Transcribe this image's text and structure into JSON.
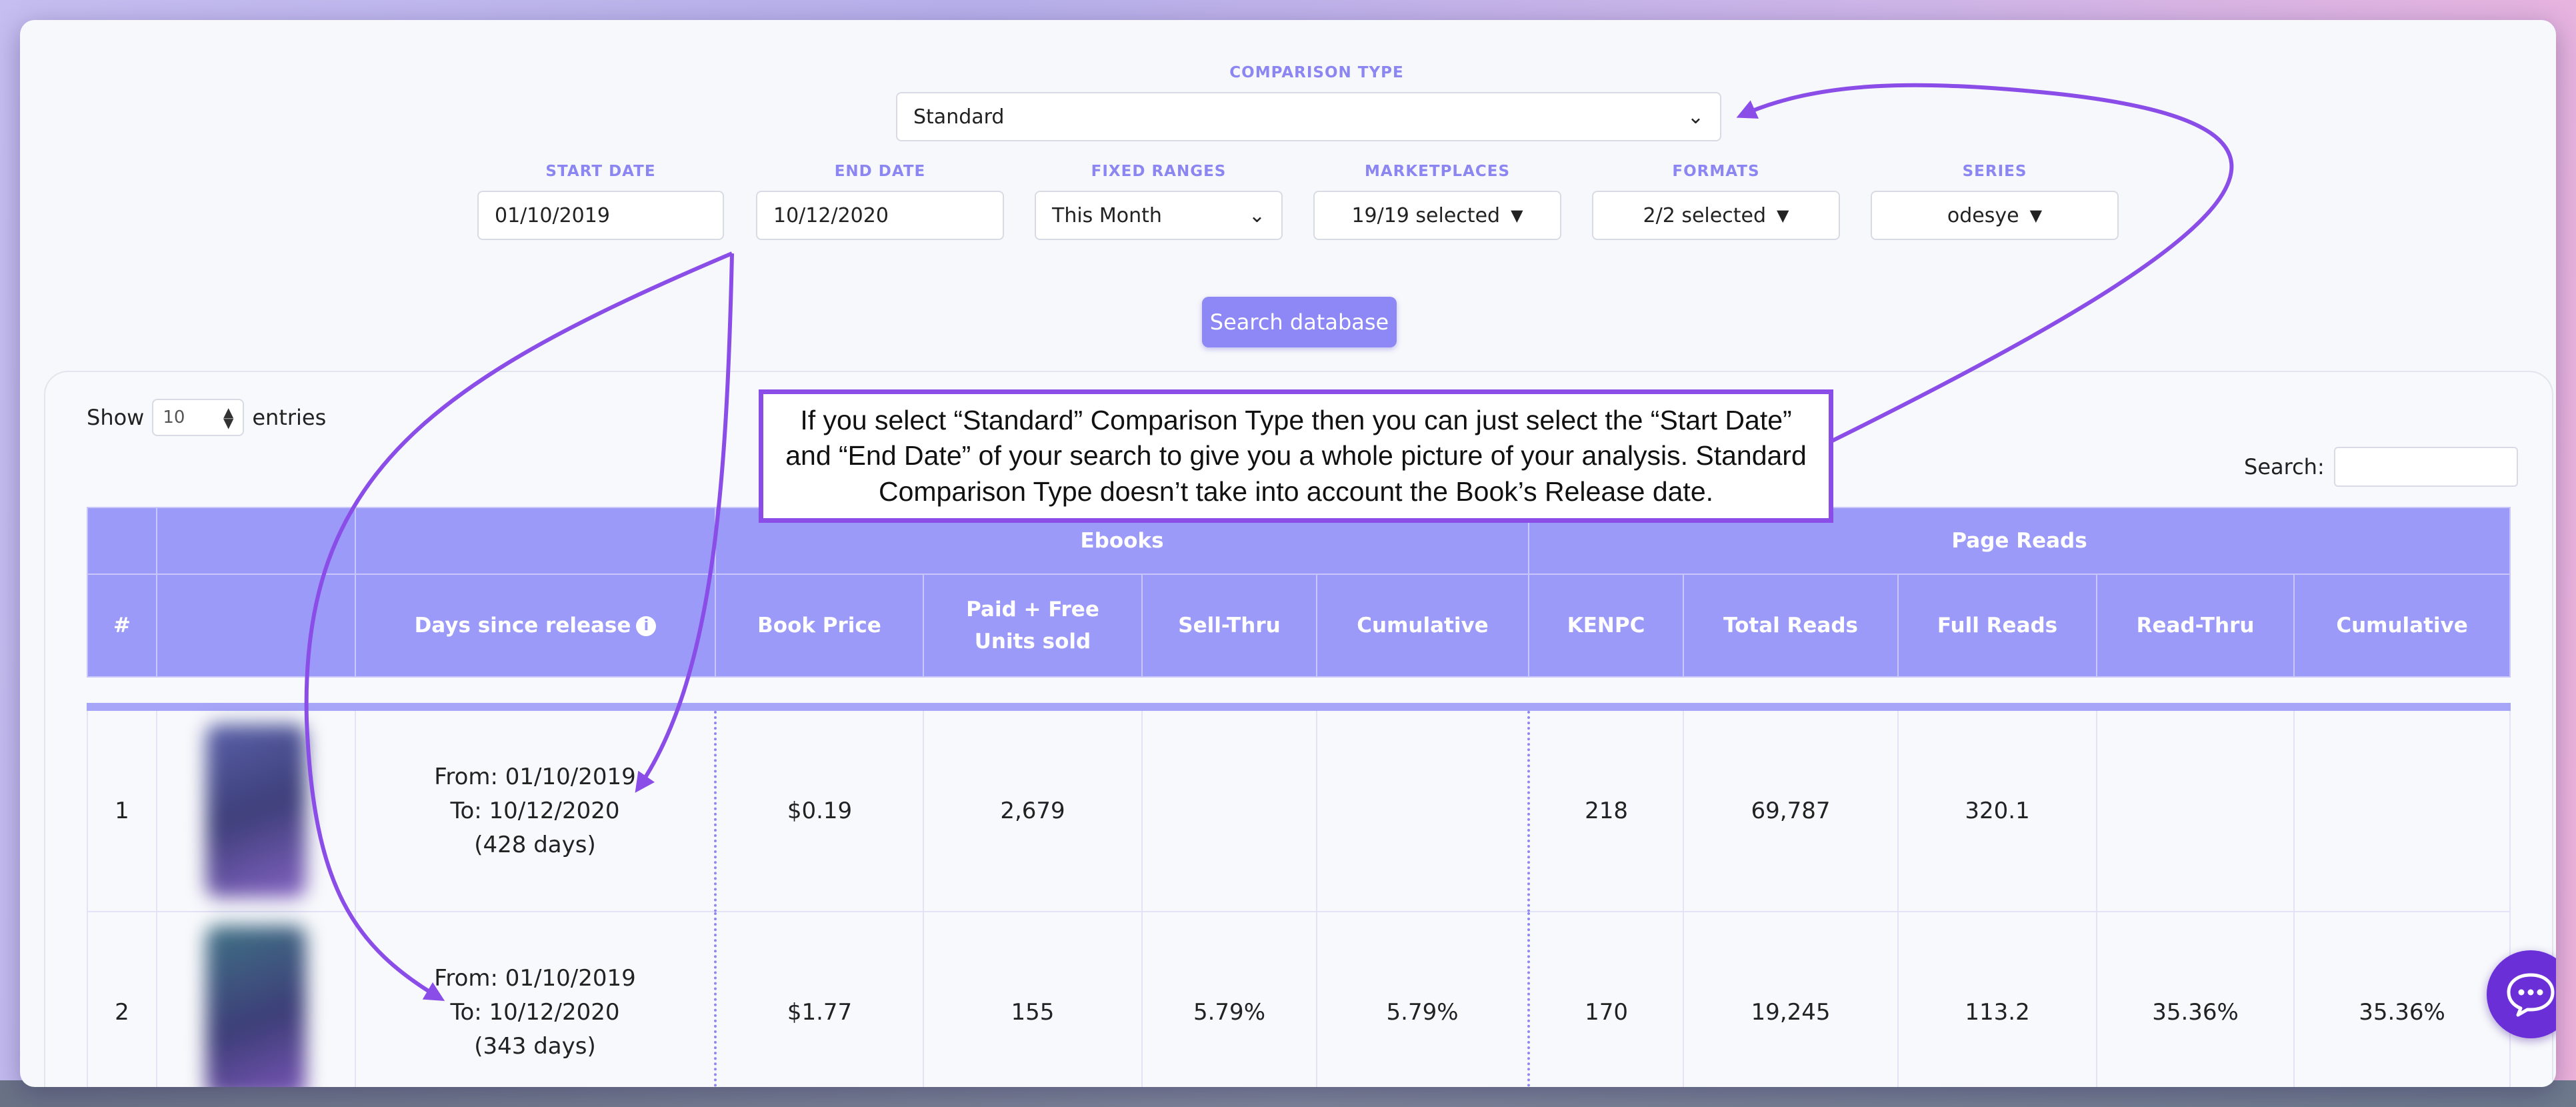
{
  "filters": {
    "comparison_type": {
      "label": "COMPARISON TYPE",
      "value": "Standard"
    },
    "start_date": {
      "label": "START DATE",
      "value": "01/10/2019"
    },
    "end_date": {
      "label": "END DATE",
      "value": "10/12/2020"
    },
    "fixed_ranges": {
      "label": "FIXED RANGES",
      "value": "This Month"
    },
    "marketplaces": {
      "label": "MARKETPLACES",
      "value": "19/19 selected"
    },
    "formats": {
      "label": "FORMATS",
      "value": "2/2 selected"
    },
    "series": {
      "label": "SERIES",
      "value": "odesye"
    },
    "search_button": "Search database"
  },
  "table_controls": {
    "show_label": "Show",
    "entries_value": "10",
    "entries_label": "entries",
    "search_label": "Search:"
  },
  "callout": {
    "text": "If you select “Standard” Comparison Type then you can just select the “Start Date” and “End Date” of your search to give you a whole picture of your analysis. Standard Comparison Type doesn’t take into account the Book’s Release date."
  },
  "table": {
    "groups": {
      "ebooks": "Ebooks",
      "page_reads": "Page Reads"
    },
    "columns": {
      "num": "#",
      "days": "Days since release",
      "book_price": "Book Price",
      "units_line1": "Paid + Free",
      "units_line2": "Units sold",
      "sell_thru": "Sell-Thru",
      "cum_ebooks": "Cumulative",
      "kenpc": "KENPC",
      "total_reads": "Total Reads",
      "full_reads": "Full Reads",
      "read_thru": "Read-Thru",
      "cum_reads": "Cumulative"
    },
    "rows": [
      {
        "num": "1",
        "from": "From: 01/10/2019",
        "to": "To: 10/12/2020",
        "days": "(428 days)",
        "book_price": "$0.19",
        "units": "2,679",
        "sell_thru": "",
        "cum_ebooks": "",
        "kenpc": "218",
        "total_reads": "69,787",
        "full_reads": "320.1",
        "read_thru": "",
        "cum_reads": ""
      },
      {
        "num": "2",
        "from": "From: 01/10/2019",
        "to": "To: 10/12/2020",
        "days": "(343 days)",
        "book_price": "$1.77",
        "units": "155",
        "sell_thru": "5.79%",
        "cum_ebooks": "5.79%",
        "kenpc": "170",
        "total_reads": "19,245",
        "full_reads": "113.2",
        "read_thru": "35.36%",
        "cum_reads": "35.36%"
      }
    ]
  },
  "colors": {
    "accent": "#8d88f6",
    "header_bg": "#9c9af9",
    "annotation": "#8b4de8",
    "chat": "#6b2fd8"
  },
  "icons": {
    "dropdown": "chevron-down-icon",
    "caret": "caret-down-icon",
    "info": "info-icon",
    "chat": "chat-icon"
  }
}
